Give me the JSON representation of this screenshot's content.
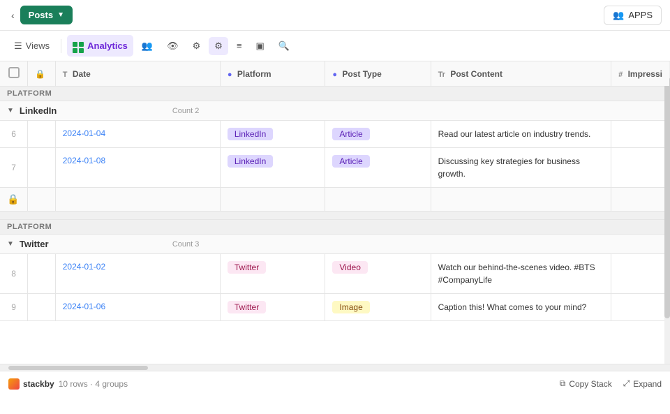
{
  "topbar": {
    "chevron_left": "‹",
    "posts_label": "Posts",
    "dropdown_arrow": "▾",
    "apps_label": "APPS",
    "apps_icon": "👥"
  },
  "toolbar": {
    "views_label": "Views",
    "analytics_label": "Analytics",
    "group_icon": "👥",
    "eye_icon": "👁",
    "filter_icon": "⚙",
    "active_filter_icon": "⚙",
    "sort_icon": "≡",
    "fields_icon": "▣",
    "search_icon": "🔍"
  },
  "table": {
    "columns": [
      {
        "id": "check",
        "label": "",
        "icon": ""
      },
      {
        "id": "lock",
        "label": "",
        "icon": "🔒"
      },
      {
        "id": "date",
        "label": "Date",
        "icon": "T"
      },
      {
        "id": "platform",
        "label": "Platform",
        "icon": "●"
      },
      {
        "id": "post_type",
        "label": "Post Type",
        "icon": "●"
      },
      {
        "id": "post_content",
        "label": "Post Content",
        "icon": "Tr"
      },
      {
        "id": "impressions",
        "label": "Impressi",
        "icon": "#"
      }
    ],
    "groups": [
      {
        "id": "linkedin-group",
        "platform_label": "PLATFORM",
        "name": "LinkedIn",
        "count_label": "Count",
        "count": 2,
        "rows": [
          {
            "id": 6,
            "date": "2024-01-04",
            "platform": "LinkedIn",
            "platform_badge": "badge-linkedin",
            "post_type": "Article",
            "post_type_badge": "badge-article",
            "post_content": "Read our latest article on industry trends."
          },
          {
            "id": 7,
            "date": "2024-01-08",
            "platform": "LinkedIn",
            "platform_badge": "badge-linkedin",
            "post_type": "Article",
            "post_type_badge": "badge-article",
            "post_content": "Discussing key strategies for business growth."
          }
        ]
      },
      {
        "id": "twitter-group",
        "platform_label": "PLATFORM",
        "name": "Twitter",
        "count_label": "Count",
        "count": 3,
        "rows": [
          {
            "id": 8,
            "date": "2024-01-02",
            "platform": "Twitter",
            "platform_badge": "badge-twitter",
            "post_type": "Video",
            "post_type_badge": "badge-video",
            "post_content": "Watch our behind-the-scenes video. #BTS #CompanyLife"
          },
          {
            "id": 9,
            "date": "2024-01-06",
            "platform": "Twitter",
            "platform_badge": "badge-twitter",
            "post_type": "Image",
            "post_type_badge": "badge-image",
            "post_content": "Caption this! What comes to your mind?"
          }
        ]
      }
    ]
  },
  "footer": {
    "rows_label": "10 rows · 4 groups",
    "copy_stack_label": "Copy Stack",
    "expand_label": "Expand",
    "brand_label": "stackby"
  }
}
